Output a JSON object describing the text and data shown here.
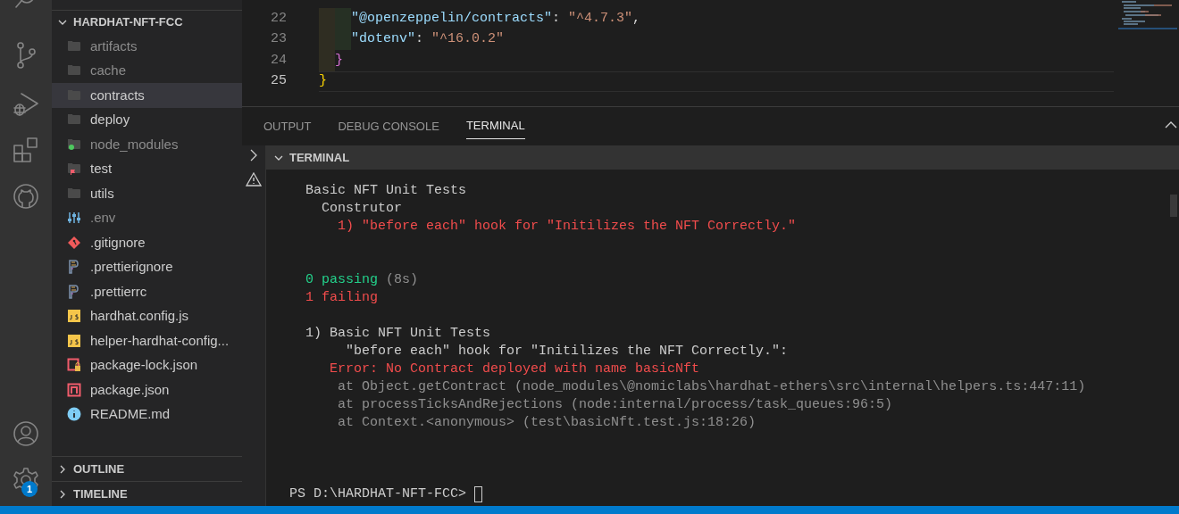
{
  "explorer": {
    "title": "HARDHAT-NFT-FCC",
    "expanded": true,
    "items": [
      {
        "label": "artifacts",
        "kind": "folder",
        "dimmed": true,
        "selected": false
      },
      {
        "label": "cache",
        "kind": "folder",
        "dimmed": true,
        "selected": false
      },
      {
        "label": "contracts",
        "kind": "folder",
        "dimmed": false,
        "selected": true
      },
      {
        "label": "deploy",
        "kind": "folder",
        "dimmed": false,
        "selected": false
      },
      {
        "label": "node_modules",
        "kind": "folder-dot",
        "dimmed": true,
        "selected": false
      },
      {
        "label": "test",
        "kind": "folder-flag",
        "dimmed": false,
        "selected": false
      },
      {
        "label": "utils",
        "kind": "folder",
        "dimmed": false,
        "selected": false
      },
      {
        "label": ".env",
        "kind": "env",
        "dimmed": true,
        "selected": false
      },
      {
        "label": ".gitignore",
        "kind": "git",
        "dimmed": false,
        "selected": false
      },
      {
        "label": ".prettierignore",
        "kind": "prettier",
        "dimmed": false,
        "selected": false
      },
      {
        "label": ".prettierrc",
        "kind": "prettier",
        "dimmed": false,
        "selected": false
      },
      {
        "label": "hardhat.config.js",
        "kind": "js",
        "dimmed": false,
        "selected": false
      },
      {
        "label": "helper-hardhat-config...",
        "kind": "js",
        "dimmed": false,
        "selected": false
      },
      {
        "label": "package-lock.json",
        "kind": "lock",
        "dimmed": false,
        "selected": false
      },
      {
        "label": "package.json",
        "kind": "npm",
        "dimmed": false,
        "selected": false
      },
      {
        "label": "README.md",
        "kind": "info",
        "dimmed": false,
        "selected": false
      }
    ]
  },
  "sidebar_sections": [
    {
      "label": "OUTLINE",
      "expanded": false
    },
    {
      "label": "TIMELINE",
      "expanded": false
    }
  ],
  "settings_badge": "1",
  "editor": {
    "lines": [
      {
        "number": "22",
        "active": false,
        "tokens": [
          {
            "kind": "indent"
          },
          {
            "kind": "indent"
          },
          {
            "kind": "key",
            "text": "\"@openzeppelin/contracts\""
          },
          {
            "kind": "punct",
            "text": ": "
          },
          {
            "kind": "string",
            "text": "\"^4.7.3\""
          },
          {
            "kind": "punct",
            "text": ","
          }
        ]
      },
      {
        "number": "23",
        "active": false,
        "tokens": [
          {
            "kind": "indent"
          },
          {
            "kind": "indent"
          },
          {
            "kind": "key",
            "text": "\"dotenv\""
          },
          {
            "kind": "punct",
            "text": ": "
          },
          {
            "kind": "string",
            "text": "\"^16.0.2\""
          }
        ]
      },
      {
        "number": "24",
        "active": false,
        "tokens": [
          {
            "kind": "indent"
          },
          {
            "kind": "bracket2",
            "text": "}"
          }
        ]
      },
      {
        "number": "25",
        "active": true,
        "tokens": [
          {
            "kind": "bracket1",
            "text": "}"
          }
        ]
      }
    ]
  },
  "panel": {
    "tabs": [
      {
        "label": "OUTPUT",
        "selected": false
      },
      {
        "label": "DEBUG CONSOLE",
        "selected": false
      },
      {
        "label": "TERMINAL",
        "selected": true
      }
    ],
    "terminal": {
      "header": "TERMINAL",
      "blocks": [
        [
          [
            {
              "kind": "plain",
              "text": "  Basic NFT Unit Tests"
            }
          ],
          [
            {
              "kind": "plain",
              "text": "    Construtor"
            }
          ],
          [
            {
              "kind": "error",
              "text": "      1) \"before each\" hook for \"Initilizes the NFT Correctly.\""
            }
          ]
        ],
        [
          [
            {
              "kind": "pass",
              "text": "  0 passing"
            },
            {
              "kind": "dim",
              "text": " (8s)"
            }
          ],
          [
            {
              "kind": "error",
              "text": "  1 failing"
            }
          ]
        ],
        [
          [
            {
              "kind": "plain",
              "text": "  1) Basic NFT Unit Tests"
            }
          ],
          [
            {
              "kind": "plain",
              "text": "       \"before each\" hook for \"Initilizes the NFT Correctly.\":"
            }
          ],
          [
            {
              "kind": "error",
              "text": "     Error: No Contract deployed with name basicNft"
            }
          ],
          [
            {
              "kind": "dim",
              "text": "      at Object.getContract (node_modules\\@nomiclabs\\hardhat-ethers\\src\\internal\\helpers.ts:447:11)"
            }
          ],
          [
            {
              "kind": "dim",
              "text": "      at processTicksAndRejections (node:internal/process/task_queues:96:5)"
            }
          ],
          [
            {
              "kind": "dim",
              "text": "      at Context.<anonymous> (test\\basicNft.test.js:18:26)"
            }
          ]
        ],
        [
          [
            {
              "kind": "plain",
              "text": "PS D:\\HARDHAT-NFT-FCC> "
            },
            {
              "kind": "cursor"
            }
          ]
        ]
      ]
    }
  }
}
